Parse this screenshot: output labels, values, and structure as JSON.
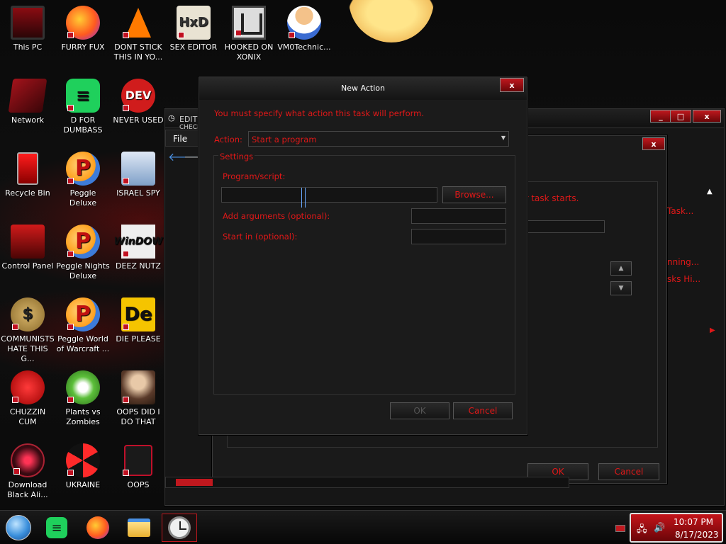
{
  "desktop": {
    "icons": [
      {
        "label": "This PC",
        "icon": "monitor-icon"
      },
      {
        "label": "FURRY FUX",
        "icon": "firefox-icon"
      },
      {
        "label": "DONT STICK THIS IN YO...",
        "icon": "vlc-cone-icon"
      },
      {
        "label": "SEX EDITOR",
        "icon": "hxd-icon"
      },
      {
        "label": "HOOKED ON XONIX",
        "icon": "maze-icon"
      },
      {
        "label": "VM0Technic...",
        "icon": "person-icon"
      },
      {
        "label": "Network",
        "icon": "network-icon"
      },
      {
        "label": "D FOR DUMBASS",
        "icon": "spotify-icon"
      },
      {
        "label": "NEVER USED",
        "icon": "devcpp-icon"
      },
      {
        "label": "Recycle Bin",
        "icon": "recycle-bin-icon"
      },
      {
        "label": "Peggle Deluxe",
        "icon": "peggle-icon"
      },
      {
        "label": "ISRAEL SPY",
        "icon": "spy-icon"
      },
      {
        "label": "Control Panel",
        "icon": "control-panel-icon"
      },
      {
        "label": "Peggle Nights Deluxe",
        "icon": "peggle-nights-icon"
      },
      {
        "label": "DEEZ NUTZ",
        "icon": "windows-icon"
      },
      {
        "label": "COMMUNISTS HATE THIS G...",
        "icon": "money-bag-icon"
      },
      {
        "label": "Peggle World of Warcraft ...",
        "icon": "peggle-wow-icon"
      },
      {
        "label": "DIE PLEASE",
        "icon": "de-icon"
      },
      {
        "label": "CHUZZIN CUM",
        "icon": "chuzzle-icon"
      },
      {
        "label": "Plants vs Zombies",
        "icon": "plants-icon"
      },
      {
        "label": "OOPS DID I DO THAT",
        "icon": "portrait-icon"
      },
      {
        "label": "Download Black Ali...",
        "icon": "alien-icon"
      },
      {
        "label": "UKRAINE",
        "icon": "radiation-icon"
      },
      {
        "label": "OOPS",
        "icon": "oops-icon"
      }
    ],
    "icon_glyphs": {
      "hxd": "HxD",
      "spotify": "≡",
      "dev": "DEV",
      "peggle": "P",
      "windows": "WinDOW",
      "money": "$",
      "de": "De"
    }
  },
  "task_window": {
    "menu_file": "File",
    "partial_left": "EDIT C",
    "partial_left2": "CHECK",
    "snip_task_starts": "ur task starts.",
    "snip_task": "Task...",
    "snip_running": "nning...",
    "snip_tasks_hi": "sks Hi...",
    "ok": "OK",
    "cancel": "Cancel"
  },
  "new_action": {
    "title": "New Action",
    "close": "x",
    "warning": "You must specify what action this task will perform.",
    "action_label": "Action:",
    "action_value": "Start a program",
    "settings_label": "Settings",
    "program_label": "Program/script:",
    "program_value": "",
    "browse": "Browse...",
    "args_label": "Add arguments (optional):",
    "start_in_label": "Start in (optional):",
    "ok": "OK",
    "cancel": "Cancel"
  },
  "taskbar": {
    "items": [
      "start-orb-icon",
      "spotify-icon",
      "firefox-icon",
      "file-explorer-icon",
      "clock-icon"
    ],
    "time": "10:07 PM",
    "date": "8/17/2023"
  }
}
